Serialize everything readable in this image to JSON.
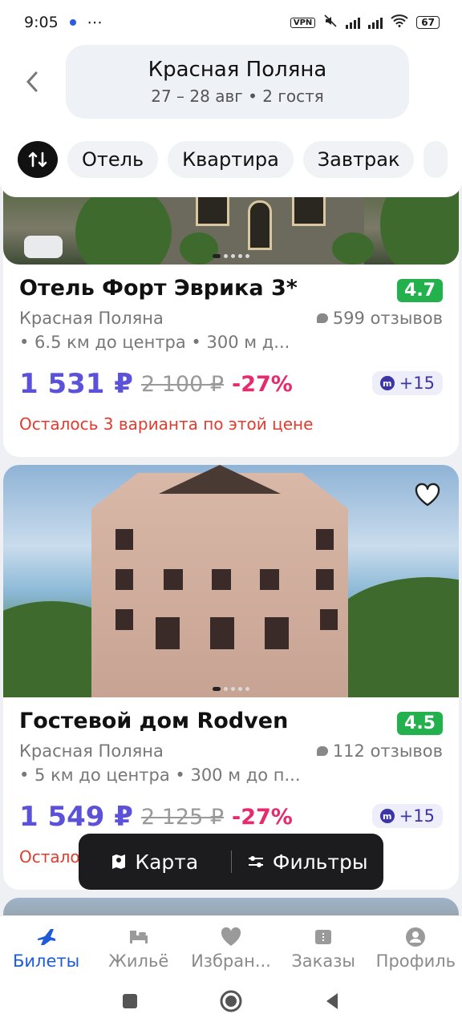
{
  "status_bar": {
    "time": "9:05",
    "more": "⋯",
    "vpn": "VPN",
    "battery": "67"
  },
  "header": {
    "title": "Красная Поляна",
    "subtitle": "27 – 28 авг • 2 гостя"
  },
  "chips": [
    {
      "label": "Отель"
    },
    {
      "label": "Квартира"
    },
    {
      "label": "Завтрак"
    }
  ],
  "hotels": [
    {
      "name": "Отель Форт Эврика 3*",
      "rating": "4.7",
      "location": "Красная Поляна",
      "reviews": "599 отзывов",
      "distance": "• 6.5 км до центра • 300 м д...",
      "price": "1 531 ₽",
      "old_price": "2 100 ₽",
      "discount": "-27%",
      "bonus": "+15",
      "note": "Осталось 3 варианта по этой цене"
    },
    {
      "name": "Гостевой дом Rodven",
      "rating": "4.5",
      "location": "Красная Поляна",
      "reviews": "112 отзывов",
      "distance": "• 5 км до центра • 300 м до п...",
      "price": "1 549 ₽",
      "old_price": "2 125 ₽",
      "discount": "-27%",
      "bonus": "+15",
      "note": "Осталось"
    }
  ],
  "floating": {
    "map_label": "Карта",
    "filters_label": "Фильтры"
  },
  "bottom_nav": [
    {
      "label": "Билеты",
      "icon": "plane-icon",
      "active": true
    },
    {
      "label": "Жильё",
      "icon": "bed-icon",
      "active": false
    },
    {
      "label": "Избран...",
      "icon": "heart-icon",
      "active": false
    },
    {
      "label": "Заказы",
      "icon": "ticket-icon",
      "active": false
    },
    {
      "label": "Профиль",
      "icon": "profile-icon",
      "active": false
    }
  ],
  "colors": {
    "accent": "#1e5bd8",
    "price": "#5b52d9",
    "discount": "#e72a6e",
    "rating_bg": "#22b14c",
    "warning": "#e33b2e"
  }
}
